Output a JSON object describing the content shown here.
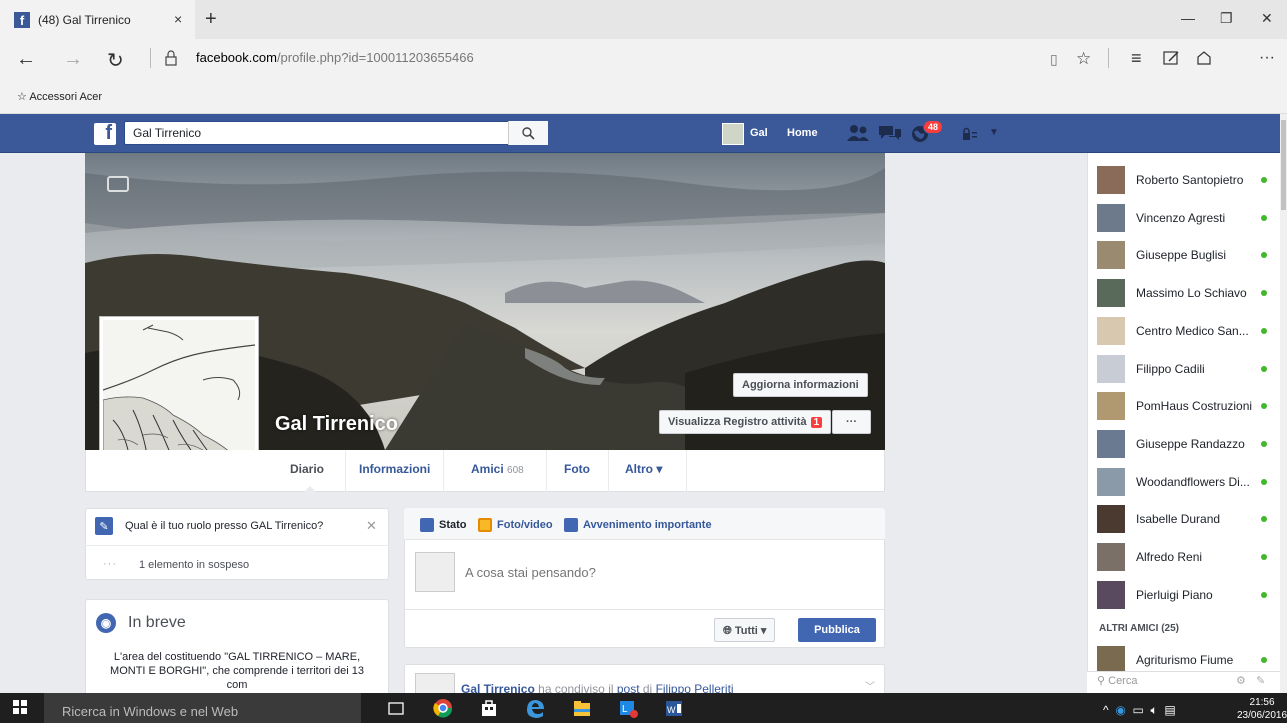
{
  "browser": {
    "tab_title": "(48) Gal Tirrenico",
    "tab_close": "×",
    "new_tab": "+",
    "url_domain": "facebook.com",
    "url_path": "/profile.php?id=100011203655466",
    "favorites_item": "Accessori Acer"
  },
  "fb": {
    "search_value": "Gal Tirrenico",
    "header_name": "Gal",
    "header_home": "Home",
    "notif_count": "48",
    "profile_name": "Gal Tirrenico",
    "btn_update": "Aggiorna informazioni",
    "btn_log": "Visualizza Registro attività",
    "btn_log_badge": "1",
    "btn_more": "···",
    "tabs": {
      "diario": "Diario",
      "info": "Informazioni",
      "amici": "Amici",
      "amici_count": "608",
      "foto": "Foto",
      "altro": "Altro ▾"
    },
    "role_question": "Qual è il tuo ruolo presso GAL Tirrenico?",
    "pending_dots": "···",
    "pending": "1 elemento in sospeso",
    "inbreve_title": "In breve",
    "inbreve_text": "L'area del costituendo \"GAL TIRRENICO – MARE, MONTI E BORGHI\", che comprende i territori dei 13 com",
    "composer": {
      "stato": "Stato",
      "foto": "Foto/video",
      "avv": "Avvenimento importante",
      "placeholder": "A cosa stai pensando?",
      "tutti": "Tutti ▾",
      "pubblica": "Pubblica"
    },
    "post": {
      "author": "Gal Tirrenico",
      "mid": " ha condiviso il ",
      "link": "post",
      "of": " di ",
      "person": "Filippo Pelleriti"
    },
    "chat": {
      "friends": [
        {
          "name": "Roberto Santopietro",
          "color": "#8a6b5a"
        },
        {
          "name": "Vincenzo Agresti",
          "color": "#6d7a8c"
        },
        {
          "name": "Giuseppe Buglisi",
          "color": "#9a8a70"
        },
        {
          "name": "Massimo Lo Schiavo",
          "color": "#5a6a5a"
        },
        {
          "name": "Centro Medico San...",
          "color": "#d8c8b0"
        },
        {
          "name": "Filippo Cadili",
          "color": "#c8ccd4"
        },
        {
          "name": "PomHaus Costruzioni",
          "color": "#b09870"
        },
        {
          "name": "Giuseppe Randazzo",
          "color": "#6a7a90"
        },
        {
          "name": "Woodandflowers Di...",
          "color": "#8a9aa8"
        },
        {
          "name": "Isabelle Durand",
          "color": "#4a3a30"
        },
        {
          "name": "Alfredo Reni",
          "color": "#7a7068"
        },
        {
          "name": "Pierluigi Piano",
          "color": "#5a4a60"
        }
      ],
      "altri_label": "ALTRI AMICI (25)",
      "altri_first": {
        "name": "Agriturismo Fiume",
        "color": "#7a6a50"
      },
      "search_placeholder": "Cerca"
    }
  },
  "taskbar": {
    "search": "Ricerca in Windows e nel Web",
    "time": "21:56",
    "date": "23/06/2016"
  }
}
